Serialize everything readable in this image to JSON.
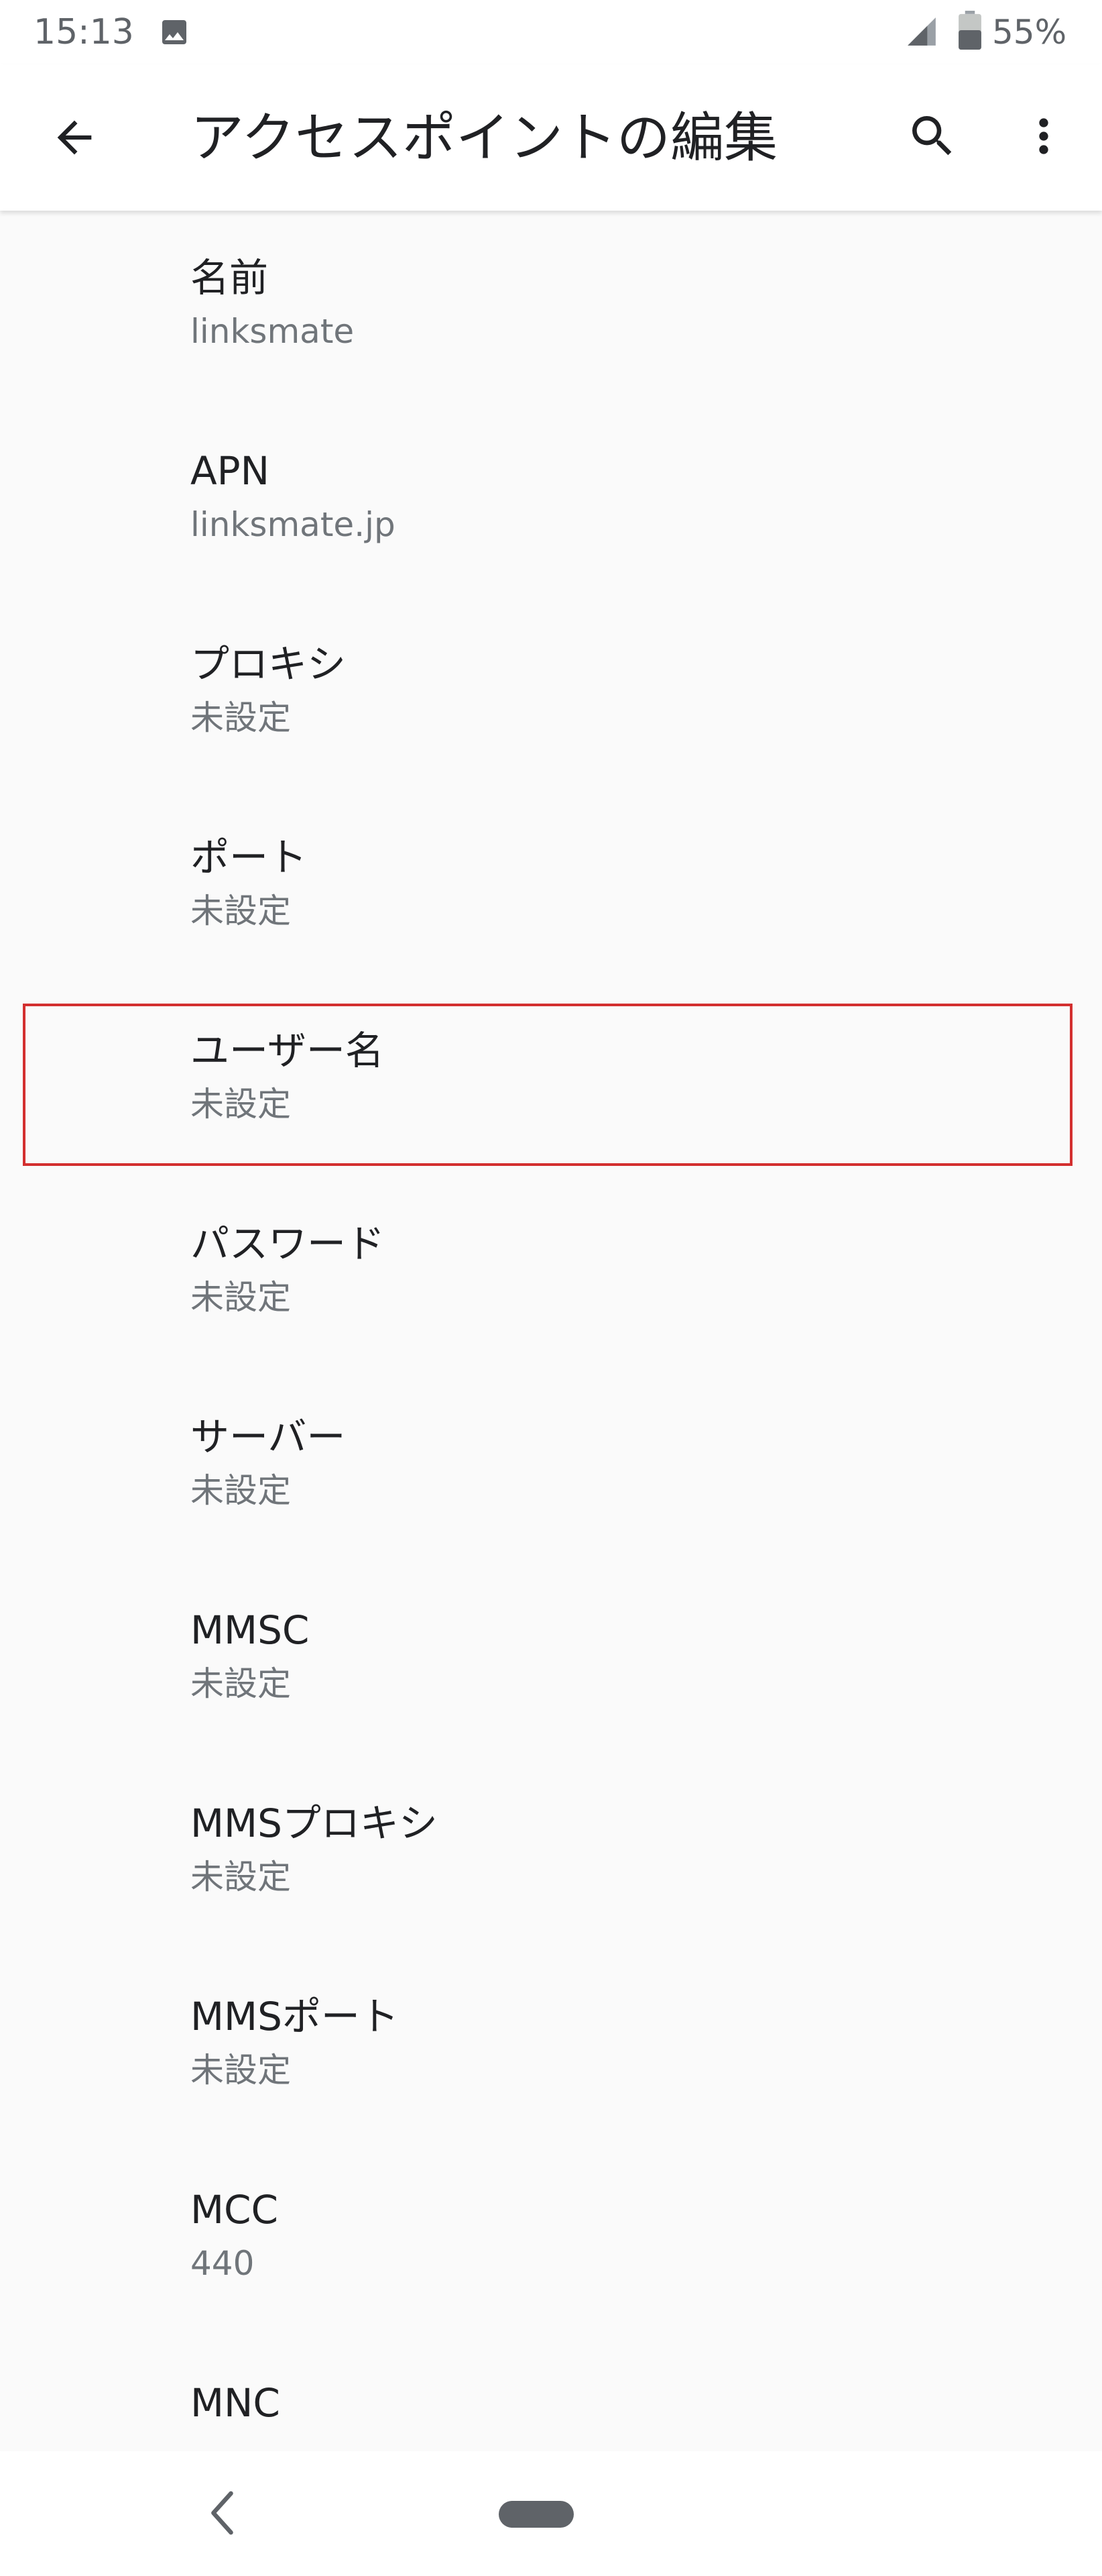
{
  "status_bar": {
    "time": "15:13",
    "battery": "55%",
    "icons": [
      "image-icon",
      "signal-icon",
      "battery-icon"
    ]
  },
  "app_bar": {
    "title": "アクセスポイントの編集",
    "icons": [
      "back-arrow-icon",
      "search-icon",
      "more-vert-icon"
    ]
  },
  "settings": {
    "items": [
      {
        "title": "名前",
        "summary": "linksmate"
      },
      {
        "title": "APN",
        "summary": "linksmate.jp"
      },
      {
        "title": "プロキシ",
        "summary": "未設定"
      },
      {
        "title": "ポート",
        "summary": "未設定"
      },
      {
        "title": "ユーザー名",
        "summary": "未設定"
      },
      {
        "title": "パスワード",
        "summary": "未設定"
      },
      {
        "title": "サーバー",
        "summary": "未設定"
      },
      {
        "title": "MMSC",
        "summary": "未設定"
      },
      {
        "title": "MMSプロキシ",
        "summary": "未設定"
      },
      {
        "title": "MMSポート",
        "summary": "未設定"
      },
      {
        "title": "MCC",
        "summary": "440"
      },
      {
        "title": "MNC",
        "summary": ""
      }
    ]
  },
  "colors": {
    "highlight": "#d32f2f",
    "background": "#fafafa",
    "title_text": "#202124",
    "summary_text": "#70757a"
  },
  "nav_bar": {
    "icons": [
      "nav-back-icon",
      "home-pill-icon"
    ]
  }
}
